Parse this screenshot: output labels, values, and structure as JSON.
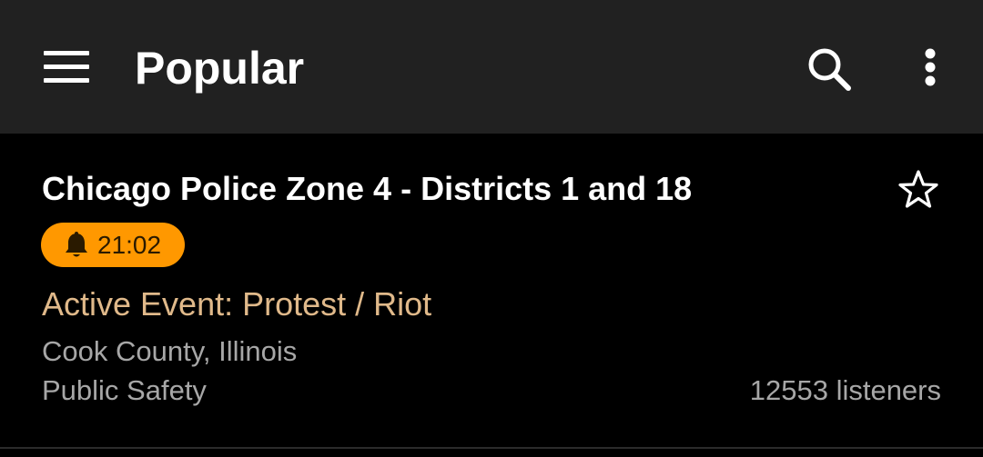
{
  "app_bar": {
    "title": "Popular",
    "menu_icon": "hamburger-menu-icon",
    "search_icon": "search-icon",
    "more_icon": "more-vert-icon",
    "background": "#212121"
  },
  "feed": {
    "title": "Chicago Police Zone 4 - Districts 1 and 18",
    "favorite_icon": "star-outline-icon",
    "alert": {
      "icon": "bell-icon",
      "time": "21:02",
      "color": "#ff9800"
    },
    "event": "Active Event: Protest / Riot",
    "event_color": "#e0b98a",
    "location": "Cook County, Illinois",
    "genre": "Public Safety",
    "listeners": "12553 listeners"
  }
}
